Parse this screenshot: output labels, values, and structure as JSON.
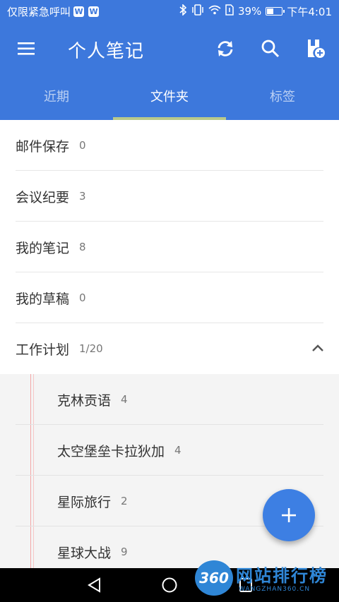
{
  "status_bar": {
    "carrier": "仅限紧急呼叫",
    "battery_percent": "39%",
    "battery_level": 0.39,
    "time": "下午4:01",
    "icons": [
      "w-app-icon",
      "w-app-icon-2",
      "bluetooth-icon",
      "vibrate-icon",
      "wifi-icon",
      "sim-icon",
      "battery-icon"
    ]
  },
  "app_bar": {
    "title": "个人笔记",
    "menu_icon": "hamburger-menu-icon",
    "sync_icon": "sync-icon",
    "search_icon": "search-icon",
    "new_note_icon": "new-notebook-icon"
  },
  "tabs": [
    {
      "label": "近期",
      "active": false
    },
    {
      "label": "文件夹",
      "active": true
    },
    {
      "label": "标签",
      "active": false
    }
  ],
  "folders": [
    {
      "name": "邮件保存",
      "count": "0"
    },
    {
      "name": "会议纪要",
      "count": "3"
    },
    {
      "name": "我的笔记",
      "count": "8"
    },
    {
      "name": "我的草稿",
      "count": "0"
    },
    {
      "name": "工作计划",
      "count": "1/20",
      "expanded": true
    }
  ],
  "subfolders": [
    {
      "name": "克林贡语",
      "count": "4"
    },
    {
      "name": "太空堡垒卡拉狄加",
      "count": "4"
    },
    {
      "name": "星际旅行",
      "count": "2"
    },
    {
      "name": "星球大战",
      "count": "9"
    }
  ],
  "fab": {
    "icon": "plus-icon"
  },
  "nav_bar": {
    "icons": [
      "back-icon",
      "home-icon",
      "recent-apps-icon"
    ]
  },
  "watermark": {
    "badge": "360",
    "title": "网站排行榜",
    "subtitle": "WANGZHAN360.CN"
  },
  "colors": {
    "primary": "#3d78dc",
    "tab_indicator": "#b9c98b",
    "fab": "#3d7fe3"
  }
}
